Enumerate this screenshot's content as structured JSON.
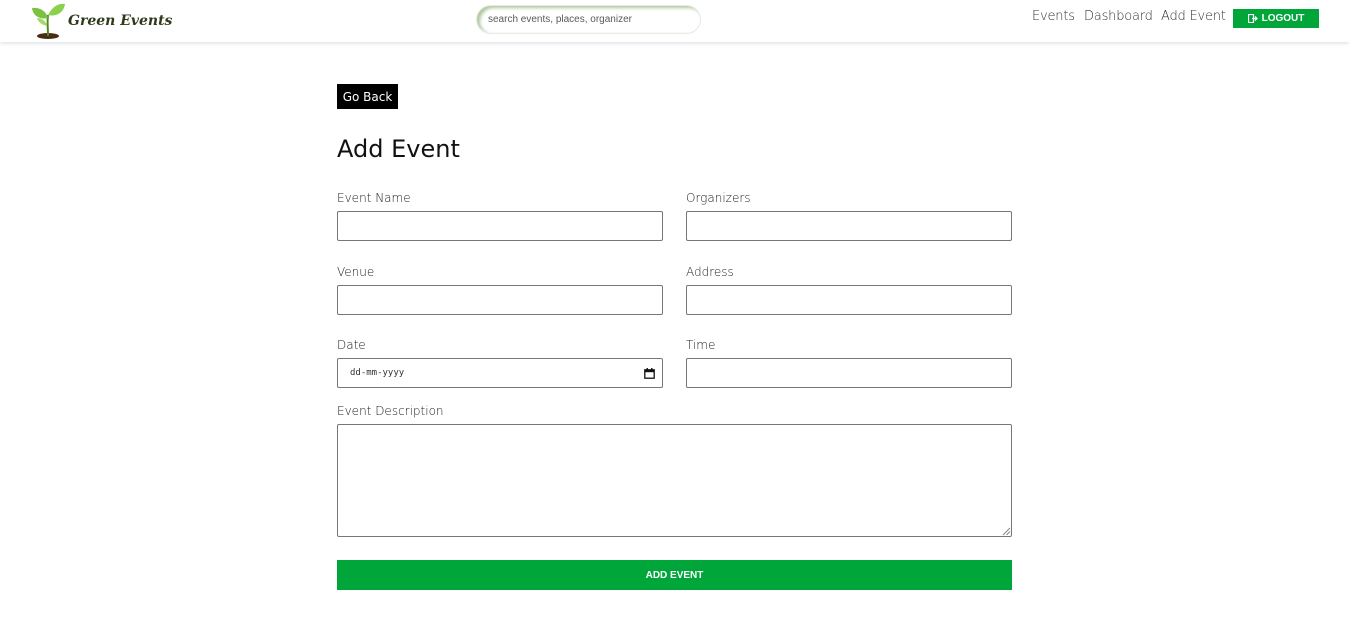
{
  "header": {
    "logo_text": "Green Events",
    "search_placeholder": "search events, places, organizer",
    "nav": {
      "events": "Events",
      "dashboard": "Dashboard",
      "add_event": "Add Event"
    },
    "logout_label": "LOGOUT",
    "accent_color": "#00a63a"
  },
  "main": {
    "go_back_label": "Go Back",
    "title": "Add Event",
    "fields": {
      "event_name": {
        "label": "Event Name",
        "value": ""
      },
      "organizers": {
        "label": "Organizers",
        "value": ""
      },
      "venue": {
        "label": "Venue",
        "value": ""
      },
      "address": {
        "label": "Address",
        "value": ""
      },
      "date": {
        "label": "Date",
        "placeholder": "dd-mm-yyyy"
      },
      "time": {
        "label": "Time",
        "value": ""
      },
      "description": {
        "label": "Event Description",
        "value": ""
      }
    },
    "submit_label": "ADD EVENT"
  },
  "icons": {
    "logo": "sprout-icon",
    "logout": "logout-icon",
    "calendar": "calendar-icon"
  }
}
